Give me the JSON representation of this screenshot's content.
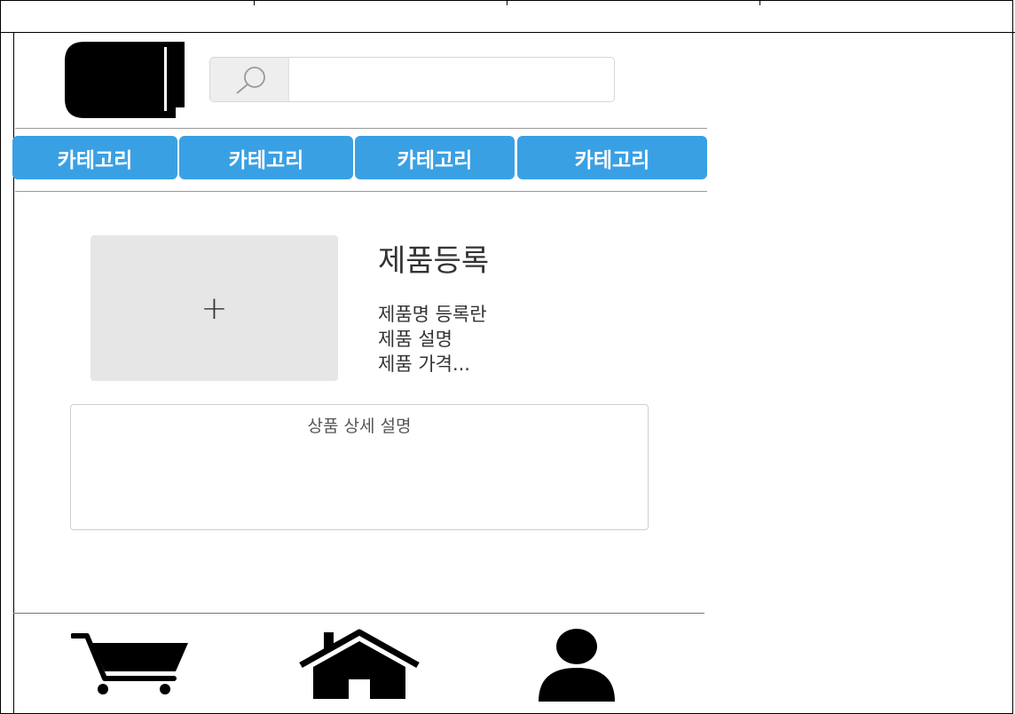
{
  "search": {
    "placeholder": "",
    "icon": "search-icon"
  },
  "categories": [
    "카테고리",
    "카테고리",
    "카테고리",
    "카테고리"
  ],
  "product_form": {
    "upload_symbol": "+",
    "title": "제품등록",
    "fields": [
      "제품명 등록란",
      "제품 설명",
      "제품 가격..."
    ],
    "detail_placeholder": "상품 상세 설명"
  },
  "bottom_nav": [
    "cart-icon",
    "home-icon",
    "user-icon"
  ],
  "colors": {
    "category_bg": "#3aa0e4",
    "category_text": "#ffffff"
  }
}
